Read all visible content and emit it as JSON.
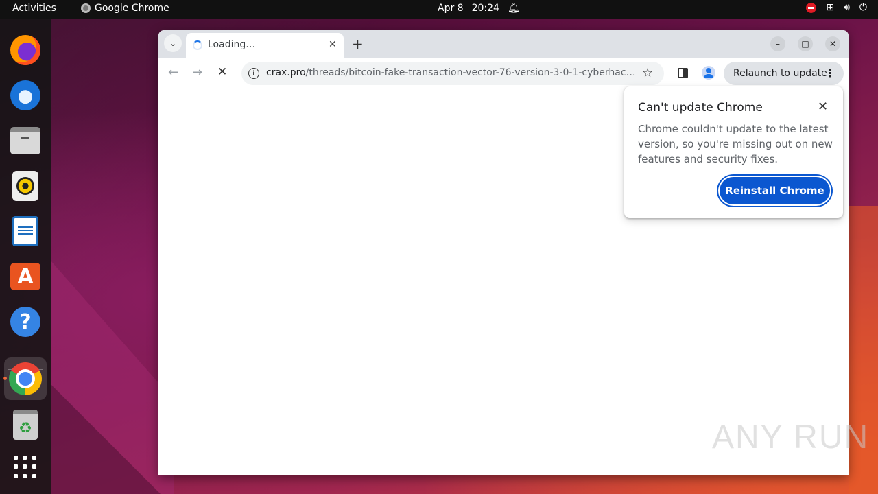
{
  "topbar": {
    "activities": "Activities",
    "app_name": "Google Chrome",
    "date": "Apr 8",
    "time": "20:24",
    "tray_icons": [
      "do-not-disturb-icon",
      "network-icon",
      "volume-icon",
      "power-icon"
    ]
  },
  "dock": {
    "items": [
      "Firefox",
      "Thunderbird",
      "Files",
      "Rhythmbox",
      "LibreOffice Writer",
      "Ubuntu Software",
      "Help",
      "Google Chrome",
      "Trash",
      "Show Applications"
    ],
    "accent": "#e95420"
  },
  "browser": {
    "tab_title": "Loading…",
    "url_host": "crax.pro",
    "url_path": "/threads/bitcoin-fake-transaction-vector-76-version-3-0-1-cyberhacklord.427…",
    "relaunch_label": "Relaunch to update",
    "accent": "#1a73e8"
  },
  "bubble": {
    "title": "Can't update Chrome",
    "body": "Chrome couldn't update to the latest version, so you're missing out on new features and security fixes.",
    "button": "Reinstall Chrome",
    "button_color": "#0b57d0"
  },
  "watermark": "ANY RUN"
}
